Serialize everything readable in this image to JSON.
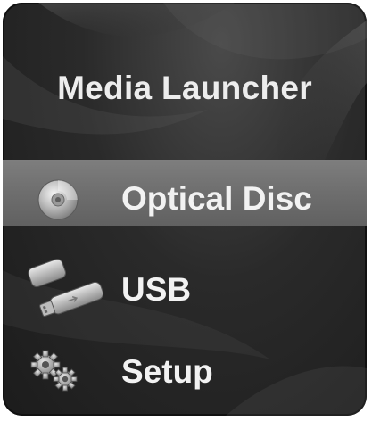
{
  "app": {
    "title": "Media Launcher"
  },
  "menu": {
    "items": [
      {
        "label": "Optical Disc",
        "icon": "optical-disc-icon",
        "selected": true
      },
      {
        "label": "USB",
        "icon": "usb-drive-icon",
        "selected": false
      },
      {
        "label": "Setup",
        "icon": "gears-icon",
        "selected": false
      }
    ]
  },
  "colors": {
    "background": "#2a2a2a",
    "selected_highlight": "#757575",
    "text": "#f2f2f2"
  }
}
